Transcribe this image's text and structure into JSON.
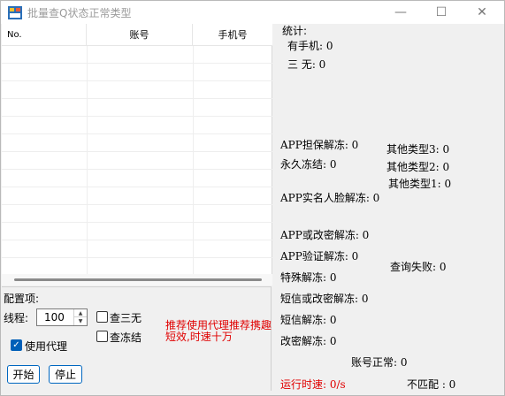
{
  "window": {
    "title": "批量查Q状态正常类型",
    "controls": {
      "minimize": "—",
      "maximize": "☐",
      "close": "✕"
    }
  },
  "list": {
    "columns": [
      "No.",
      "账号",
      "手机号"
    ],
    "rows": []
  },
  "config": {
    "title": "配置项:",
    "threads_label": "线程:",
    "threads_value": "100",
    "use_proxy_label": "使用代理",
    "use_proxy_checked": true,
    "check_sanwu_label": "查三无",
    "check_sanwu_checked": false,
    "check_frozen_label": "查冻结",
    "check_frozen_checked": false,
    "notice": "推荐使用代理推荐携趣 短效,时速十万",
    "start_label": "开始",
    "stop_label": "停止"
  },
  "stats": {
    "heading": "统计:",
    "has_phone": "有手机: 0",
    "sanwu": "三  无: 0",
    "app_guarantee": "APP担保解冻: 0",
    "permanent_frozen": "永久冻结: 0",
    "app_face": "APP实名人脸解冻: 0",
    "other_type3": "其他类型3: 0",
    "other_type2": "其他类型2: 0",
    "other_type1": "其他类型1: 0",
    "app_or_pwd": "APP或改密解冻: 0",
    "app_verify": "APP验证解冻: 0",
    "special": "特殊解冻: 0",
    "query_failed": "查询失败: 0",
    "sms_or_pwd": "短信或改密解冻: 0",
    "sms": "短信解冻: 0",
    "change_pwd": "改密解冻: 0",
    "normal": "账号正常: 0",
    "speed": "运行时速: 0/s",
    "mismatch": "不匹配 : 0"
  },
  "colors": {
    "accent": "#0067c0",
    "warning": "#e00000"
  }
}
